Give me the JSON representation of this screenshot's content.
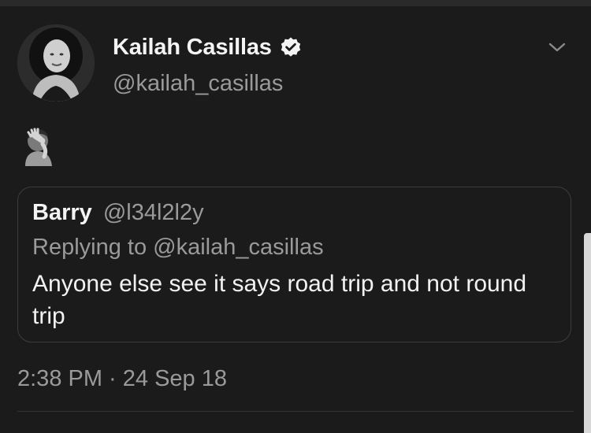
{
  "tweet": {
    "display_name": "Kailah Casillas",
    "handle": "@kailah_casillas",
    "verified": true,
    "emoji": "🤦‍♀️",
    "timestamp": "2:38 PM · 24 Sep 18"
  },
  "quoted_tweet": {
    "name": "Barry",
    "handle": "@l34l2l2y",
    "replying_to": "Replying to @kailah_casillas",
    "text": "Anyone else see it says road trip and not round trip"
  },
  "icons": {
    "avatar": "profile-photo",
    "verified": "verified-badge-icon",
    "menu": "chevron-down-icon",
    "emoji": "face-palm-emoji"
  },
  "colors": {
    "background": "#1b1b1b",
    "primary_text": "#f2f2f2",
    "secondary_text": "#9a9a9a",
    "border": "#3d3d3d"
  }
}
